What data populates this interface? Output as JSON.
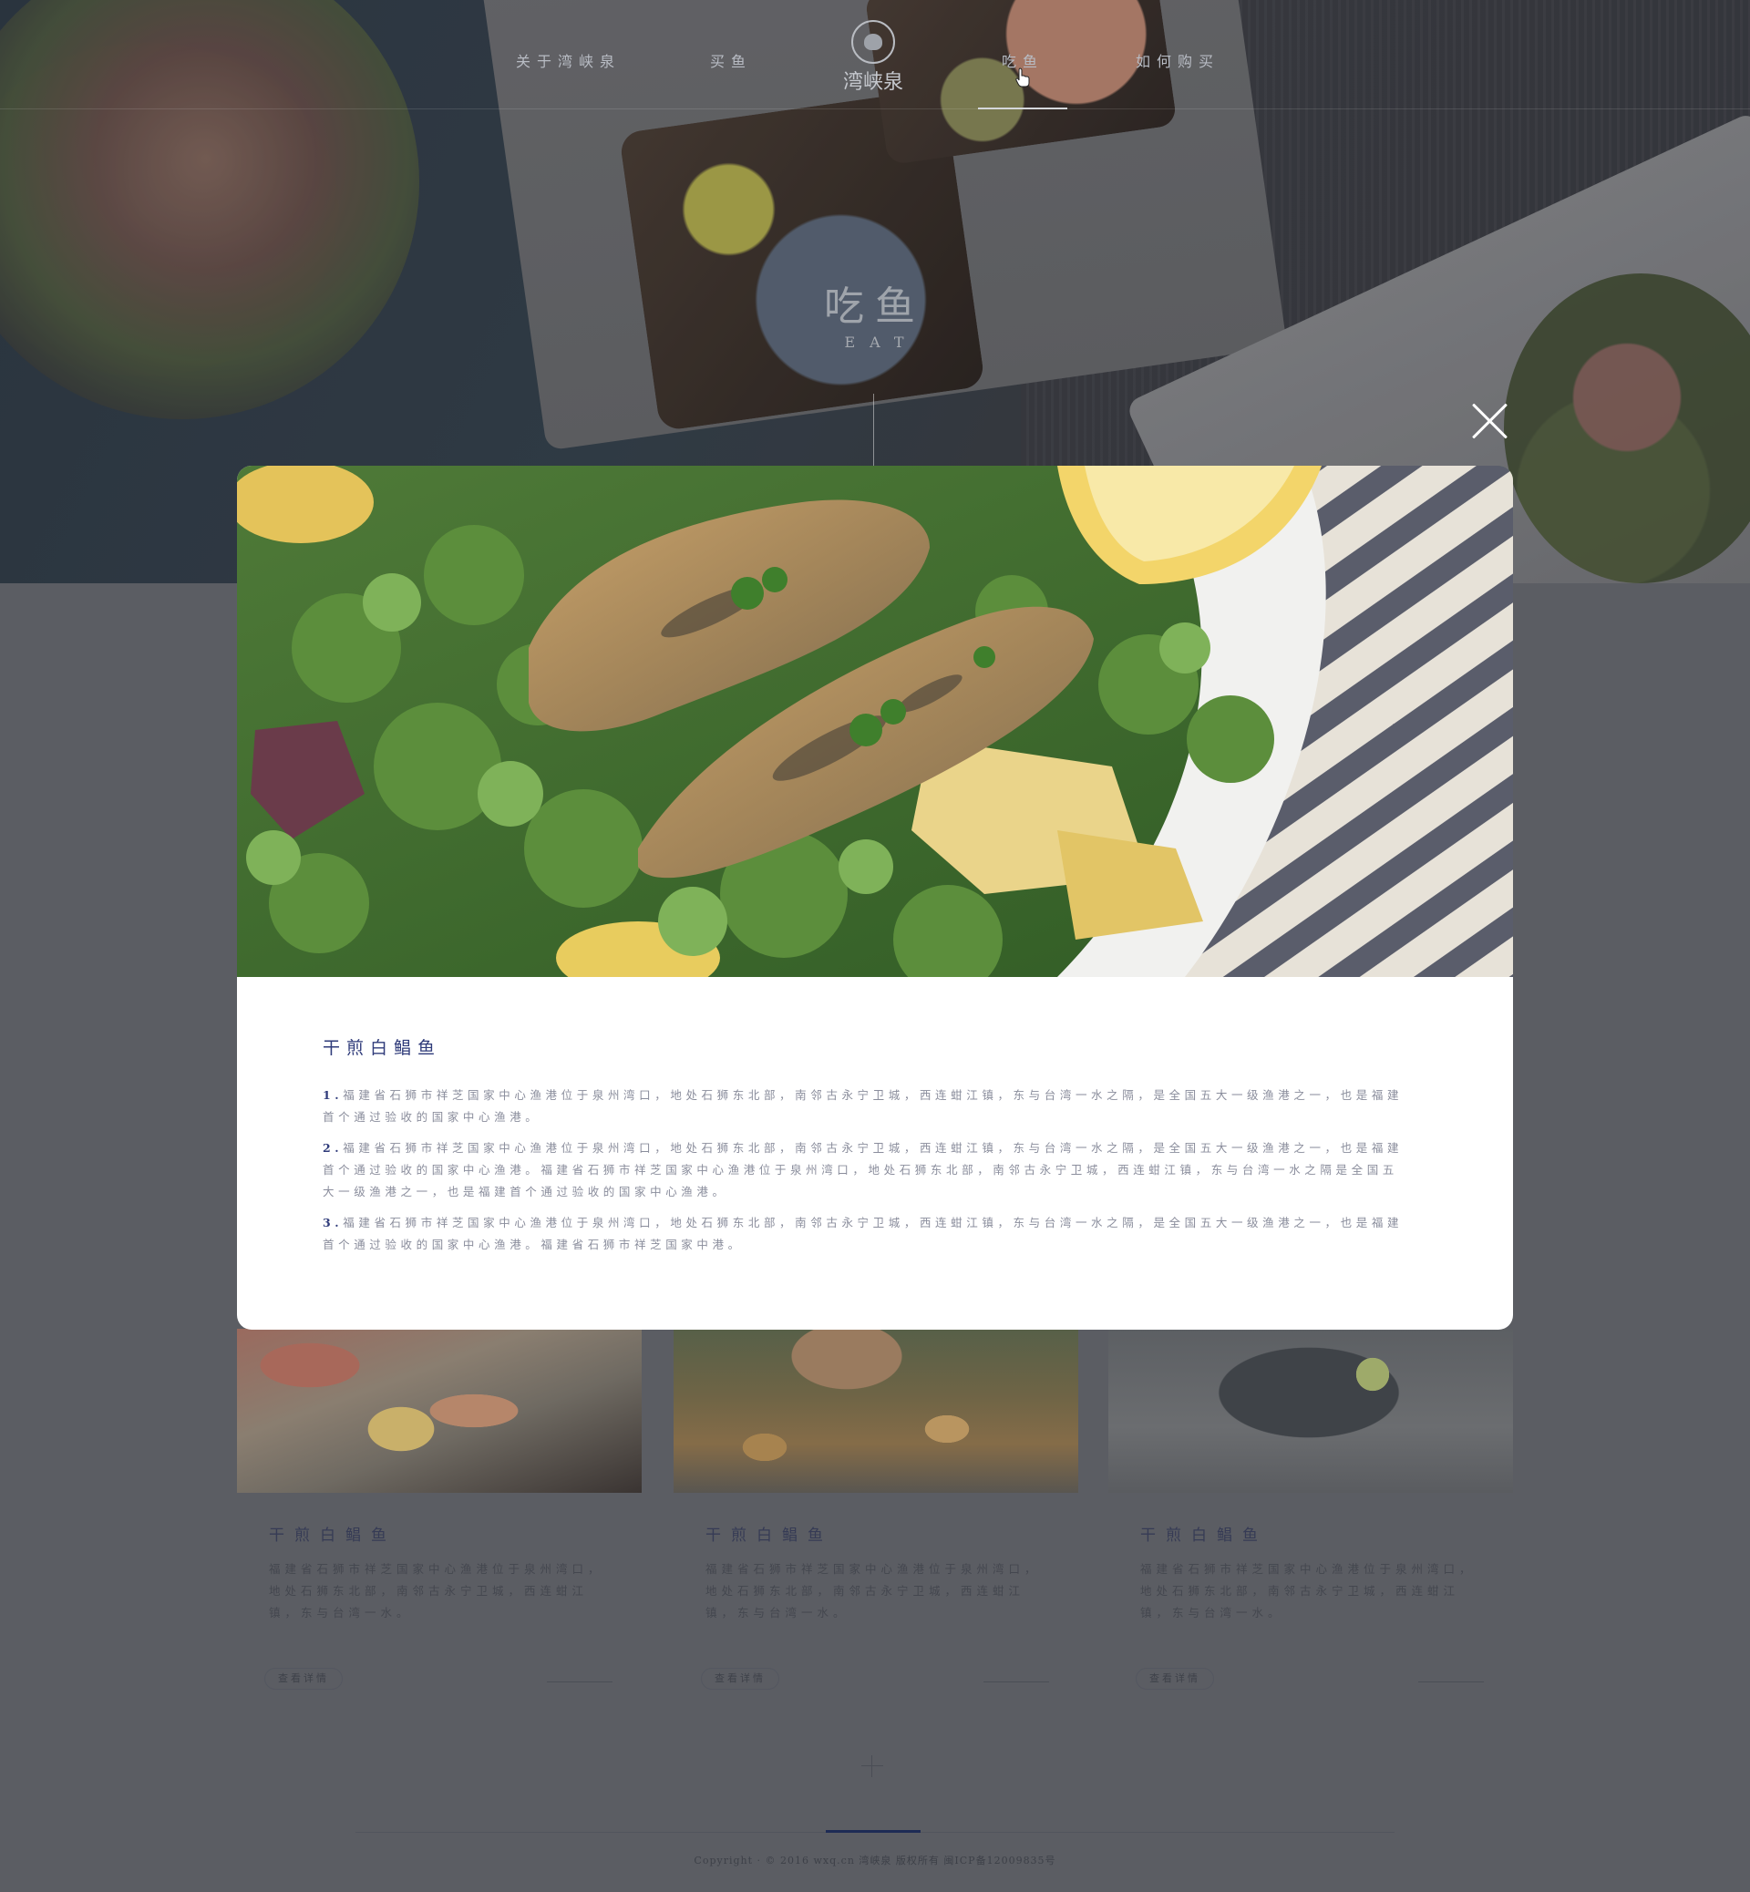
{
  "nav": {
    "items": [
      {
        "label": "关于湾峡泉"
      },
      {
        "label": "买鱼"
      },
      {
        "label": "吃鱼",
        "active": true
      },
      {
        "label": "如何购买"
      }
    ],
    "logo_text": "湾峡泉"
  },
  "hero": {
    "title": "吃鱼",
    "subtitle": "EAT"
  },
  "modal": {
    "title": "干煎白鲳鱼",
    "paragraphs": [
      {
        "num": "1.",
        "text": "福建省石狮市祥芝国家中心渔港位于泉州湾口，地处石狮东北部，南邻古永宁卫城，西连蚶江镇，东与台湾一水之隔，是全国五大一级渔港之一，也是福建首个通过验收的国家中心渔港。"
      },
      {
        "num": "2.",
        "text": "福建省石狮市祥芝国家中心渔港位于泉州湾口，地处石狮东北部，南邻古永宁卫城，西连蚶江镇，东与台湾一水之隔，是全国五大一级渔港之一，也是福建首个通过验收的国家中心渔港。福建省石狮市祥芝国家中心渔港位于泉州湾口，地处石狮东北部，南邻古永宁卫城，西连蚶江镇，东与台湾一水之隔是全国五大一级渔港之一，也是福建首个通过验收的国家中心渔港。"
      },
      {
        "num": "3.",
        "text": "福建省石狮市祥芝国家中心渔港位于泉州湾口，地处石狮东北部，南邻古永宁卫城，西连蚶江镇，东与台湾一水之隔，是全国五大一级渔港之一，也是福建首个通过验收的国家中心渔港。福建省石狮市祥芝国家中港。"
      }
    ]
  },
  "cards": [
    {
      "title": "干煎白鲳鱼",
      "desc": "福建省石狮市祥芝国家中心渔港位于泉州湾口，地处石狮东北部，南邻古永宁卫城，西连蚶江镇，东与台湾一水。",
      "button": "查看详情"
    },
    {
      "title": "干煎白鲳鱼",
      "desc": "福建省石狮市祥芝国家中心渔港位于泉州湾口，地处石狮东北部，南邻古永宁卫城，西连蚶江镇，东与台湾一水。",
      "button": "查看详情"
    },
    {
      "title": "干煎白鲳鱼",
      "desc": "福建省石狮市祥芝国家中心渔港位于泉州湾口，地处石狮东北部，南邻古永宁卫城，西连蚶江镇，东与台湾一水。",
      "button": "查看详情"
    }
  ],
  "footer": {
    "copyright": "Copyright · © 2016 wxq.cn 湾峡泉 版权所有 闽ICP备12009835号"
  },
  "icons": {
    "close": "close-icon",
    "cursor": "hand-pointer-icon",
    "more": "plus-icon"
  },
  "colors": {
    "accent": "#2f3b7a",
    "overlay": "#5b5d63",
    "modal_bg": "#ffffff"
  }
}
